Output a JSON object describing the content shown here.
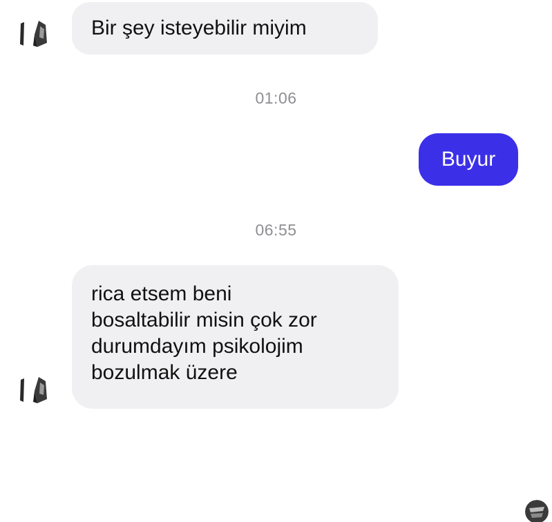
{
  "messages": [
    {
      "direction": "incoming",
      "text": "Bir şey isteyebilir miyim"
    },
    {
      "direction": "timestamp",
      "text": "01:06"
    },
    {
      "direction": "outgoing",
      "text": "Buyur"
    },
    {
      "direction": "timestamp",
      "text": "06:55"
    },
    {
      "direction": "incoming",
      "lines": [
        "rica etsem beni",
        "bosaltabilir misin çok zor",
        "durumdayım psikolojim",
        "bozulmak üzere"
      ]
    }
  ],
  "colors": {
    "incoming_bubble": "#f0f0f2",
    "outgoing_bubble": "#3c2fe8",
    "timestamp": "#8e8e93"
  },
  "icons": {
    "contact_avatar": "avatar-icon",
    "reader_avatar": "read-receipt-avatar-icon"
  }
}
